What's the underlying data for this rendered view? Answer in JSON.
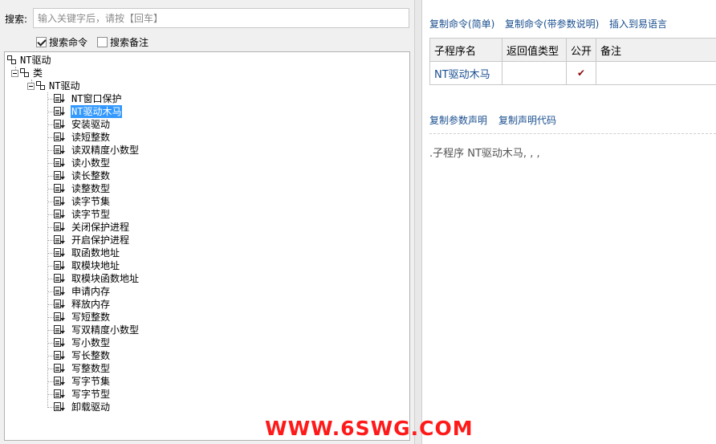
{
  "search": {
    "label": "搜索:",
    "placeholder": "输入关键字后，请按【回车】"
  },
  "filters": [
    {
      "label": "搜索命令",
      "checked": true
    },
    {
      "label": "搜索备注",
      "checked": false
    }
  ],
  "tree": {
    "root": "NT驱动",
    "class_folder": "类",
    "class_name": "NT驱动",
    "selected": "NT驱动木马",
    "methods": [
      "NT窗口保护",
      "NT驱动木马",
      "安装驱动",
      "读短整数",
      "读双精度小数型",
      "读小数型",
      "读长整数",
      "读整数型",
      "读字节集",
      "读字节型",
      "关闭保护进程",
      "开启保护进程",
      "取函数地址",
      "取模块地址",
      "取模块函数地址",
      "申请内存",
      "释放内存",
      "写短整数",
      "写双精度小数型",
      "写小数型",
      "写长整数",
      "写整数型",
      "写字节集",
      "写字节型",
      "卸载驱动"
    ]
  },
  "right": {
    "links_top": [
      "复制命令(简单)",
      "复制命令(带参数说明)",
      "插入到易语言"
    ],
    "table": {
      "headers": [
        "子程序名",
        "返回值类型",
        "公开",
        "备注"
      ],
      "row": {
        "name": "NT驱动木马",
        "return_type": "",
        "public": "✔",
        "note": ""
      }
    },
    "links_mid": [
      "复制参数声明",
      "复制声明代码"
    ],
    "declaration": ".子程序 NT驱动木马, , ,"
  },
  "watermark": "WWW.6SWG.COM",
  "colors": {
    "link": "#1a4f8f",
    "selection": "#3399ff",
    "check": "#8b0a0a",
    "watermark": "#ff1a1a"
  }
}
